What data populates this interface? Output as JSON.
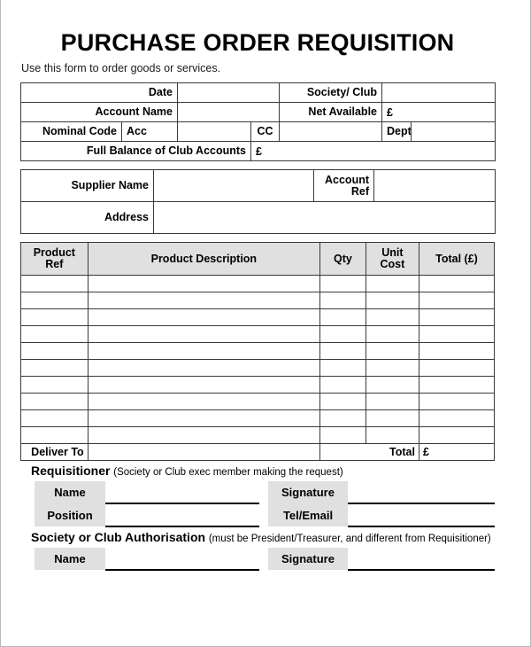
{
  "document": {
    "title": "PURCHASE ORDER REQUISITION",
    "subtitle": "Use this form to order goods or services."
  },
  "header_fields": {
    "date_label": "Date",
    "date_value": "",
    "society_club_label": "Society/ Club",
    "society_club_value": "",
    "account_name_label": "Account Name",
    "account_name_value": "",
    "net_available_label": "Net Available",
    "net_available_value": "£",
    "nominal_code_label": "Nominal Code",
    "acc_label": "Acc",
    "acc_value": "",
    "cc_label": "CC",
    "cc_value": "",
    "dept_label": "Dept",
    "dept_value": "",
    "full_balance_label": "Full Balance of Club Accounts",
    "full_balance_value": "£"
  },
  "supplier": {
    "supplier_name_label": "Supplier Name",
    "supplier_name_value": "",
    "account_ref_label": "Account Ref",
    "account_ref_value": "",
    "address_label": "Address",
    "address_value": ""
  },
  "items_table": {
    "columns": [
      "Product Ref",
      "Product Description",
      "Qty",
      "Unit Cost",
      "Total (£)"
    ],
    "rows": [
      {
        "product_ref": "",
        "description": "",
        "qty": "",
        "unit_cost": "",
        "total": ""
      },
      {
        "product_ref": "",
        "description": "",
        "qty": "",
        "unit_cost": "",
        "total": ""
      },
      {
        "product_ref": "",
        "description": "",
        "qty": "",
        "unit_cost": "",
        "total": ""
      },
      {
        "product_ref": "",
        "description": "",
        "qty": "",
        "unit_cost": "",
        "total": ""
      },
      {
        "product_ref": "",
        "description": "",
        "qty": "",
        "unit_cost": "",
        "total": ""
      },
      {
        "product_ref": "",
        "description": "",
        "qty": "",
        "unit_cost": "",
        "total": ""
      },
      {
        "product_ref": "",
        "description": "",
        "qty": "",
        "unit_cost": "",
        "total": ""
      },
      {
        "product_ref": "",
        "description": "",
        "qty": "",
        "unit_cost": "",
        "total": ""
      },
      {
        "product_ref": "",
        "description": "",
        "qty": "",
        "unit_cost": "",
        "total": ""
      },
      {
        "product_ref": "",
        "description": "",
        "qty": "",
        "unit_cost": "",
        "total": ""
      }
    ],
    "deliver_to_label": "Deliver To",
    "deliver_to_value": "",
    "total_label": "Total",
    "total_value": "£"
  },
  "requisitioner": {
    "heading": "Requisitioner",
    "note": "(Society or Club exec member making the request)",
    "name_label": "Name",
    "name_value": "",
    "signature_label": "Signature",
    "signature_value": "",
    "position_label": "Position",
    "position_value": "",
    "tel_email_label": "Tel/Email",
    "tel_email_value": ""
  },
  "authorisation": {
    "heading": "Society or Club Authorisation",
    "note": "(must be President/Treasurer, and different from Requisitioner)",
    "name_label": "Name",
    "name_value": "",
    "signature_label": "Signature",
    "signature_value": ""
  },
  "colors": {
    "label_fill": "#e0e0e0",
    "total_fill": "#d8d8d8",
    "border": "#3a3a3a",
    "text": "#000000",
    "page_background": "#ffffff"
  }
}
